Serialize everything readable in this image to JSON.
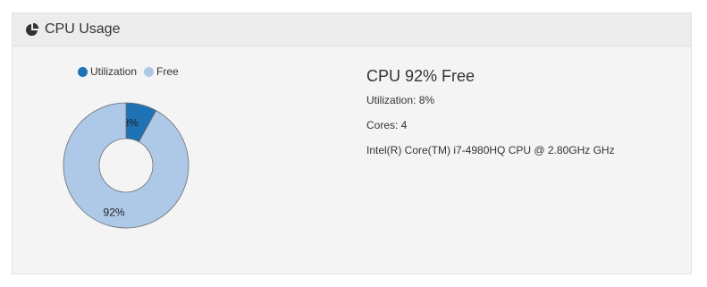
{
  "panel": {
    "title": "CPU Usage",
    "icon": "pie-chart-icon"
  },
  "colors": {
    "utilization": "#1f72b4",
    "free": "#aec8e8"
  },
  "chart_data": {
    "type": "pie",
    "categories": [
      "Utilization",
      "Free"
    ],
    "values": [
      8,
      92
    ],
    "data_labels": [
      "8%",
      "92%"
    ],
    "legend": "top"
  },
  "info": {
    "title": "CPU 92% Free",
    "utilization": "Utilization: 8%",
    "cores": "Cores: 4",
    "processor": "Intel(R) Core(TM) i7-4980HQ CPU @ 2.80GHz GHz"
  }
}
